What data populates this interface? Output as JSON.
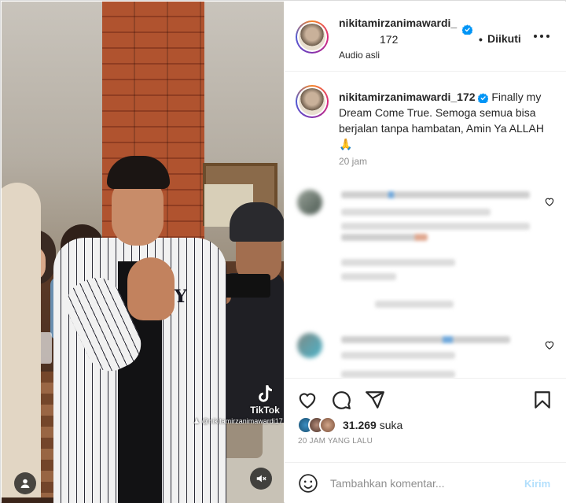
{
  "header": {
    "username_line1": "nikitamirzanimawardi_",
    "username_line2": "172",
    "dot": "•",
    "follow_label": "Diikuti",
    "audio_label": "Audio asli"
  },
  "video": {
    "tiktok_label": "TikTok",
    "watermark": "@nikitamirzanimawardi17"
  },
  "caption": {
    "username": "nikitamirzanimawardi_172",
    "text": "Finally my Dream Come True. Semoga semua bisa berjalan tanpa hambatan, Amin Ya ALLAH 🙏",
    "time": "20 jam"
  },
  "actions": {
    "likes_count": "31.269",
    "likes_word": "suka",
    "time_ago": "20 JAM YANG LALU"
  },
  "composer": {
    "placeholder": "Tambahkan komentar...",
    "post_label": "Kirim"
  },
  "icons": {
    "verified": "verified-badge-icon",
    "more": "more-options-icon",
    "like": "heart-icon",
    "comment": "comment-icon",
    "share": "share-icon",
    "save": "bookmark-icon",
    "emoji": "emoji-icon",
    "mute": "mute-icon",
    "user": "user-tag-icon"
  },
  "colors": {
    "verified": "#0095f6",
    "post_disabled": "#b2dffc",
    "secondary_text": "#8e8e8e"
  }
}
